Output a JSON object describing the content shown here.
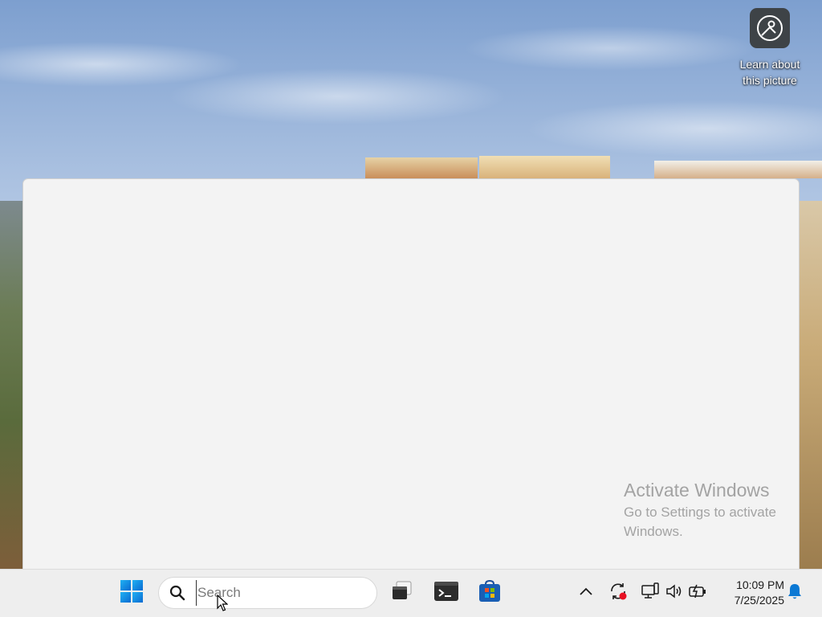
{
  "desktop": {
    "icons": [
      {
        "label": "Learn about this picture",
        "icon": "learn-about-picture-icon"
      }
    ]
  },
  "watermark": {
    "title": "Activate Windows",
    "subtitle": "Go to Settings to activate Windows."
  },
  "taskbar": {
    "start_icon": "windows-logo-icon",
    "search": {
      "placeholder": "Search",
      "value": ""
    },
    "apps": [
      {
        "name": "task-view",
        "icon": "task-view-icon"
      },
      {
        "name": "terminal",
        "icon": "terminal-icon"
      },
      {
        "name": "microsoft-store",
        "icon": "store-icon"
      }
    ],
    "tray": {
      "icons": [
        "chevron-up-icon",
        "sync-icon",
        "network-icon",
        "volume-icon",
        "battery-icon"
      ],
      "time": "10:09 PM",
      "date": "7/25/2025",
      "notification_icon": "bell-icon"
    }
  },
  "colors": {
    "taskbar_bg": "#eeeeee",
    "window_bg": "#f3f3f3",
    "accent_blue": "#0a78d4",
    "alert_red": "#e81123",
    "watermark_text": "#a3a3a3"
  }
}
